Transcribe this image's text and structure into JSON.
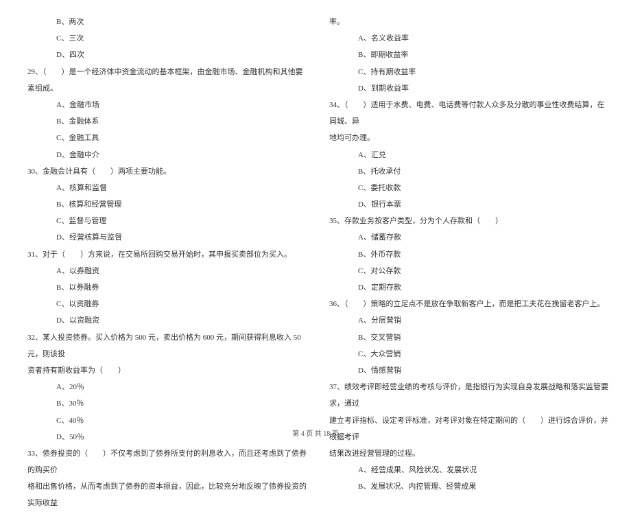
{
  "left_column": [
    {
      "type": "option",
      "text": "B、两次"
    },
    {
      "type": "option",
      "text": "C、三次"
    },
    {
      "type": "option",
      "text": "D、四次"
    },
    {
      "type": "question",
      "text": "29、（　　）是一个经济体中资金流动的基本框架，由金融市场、金融机构和其他要素组成。"
    },
    {
      "type": "option",
      "text": "A、金融市场"
    },
    {
      "type": "option",
      "text": "B、金融体系"
    },
    {
      "type": "option",
      "text": "C、金融工具"
    },
    {
      "type": "option",
      "text": "D、金融中介"
    },
    {
      "type": "question",
      "text": "30、金融会计具有（　　）两项主要功能。"
    },
    {
      "type": "option",
      "text": "A、核算和监督"
    },
    {
      "type": "option",
      "text": "B、核算和经营管理"
    },
    {
      "type": "option",
      "text": "C、监督与管理"
    },
    {
      "type": "option",
      "text": "D、经营核算与监督"
    },
    {
      "type": "question",
      "text": "31、对于（　　）方来说，在交易所回购交易开始时，其申报买卖部位为买入。"
    },
    {
      "type": "option",
      "text": "A、以券融资"
    },
    {
      "type": "option",
      "text": "B、以券融券"
    },
    {
      "type": "option",
      "text": "C、以资融券"
    },
    {
      "type": "option",
      "text": "D、以资融资"
    },
    {
      "type": "question",
      "text": "32、某人投资债券。买入价格为 500 元，卖出价格为 600 元，期间获得利息收入 50 元，则该投"
    },
    {
      "type": "question-cont",
      "text": "资者持有期收益率为（　　）"
    },
    {
      "type": "option",
      "text": "A、20％"
    },
    {
      "type": "option",
      "text": "B、30％"
    },
    {
      "type": "option",
      "text": "C、40％"
    },
    {
      "type": "option",
      "text": "D、50％"
    },
    {
      "type": "question",
      "text": "33、债券投资的（　　）不仅考虑到了债券所支付的利息收入，而且还考虑到了债券的购买价"
    },
    {
      "type": "question-cont",
      "text": "格和出售价格，从而考虑到了债券的资本损益，因此，比较充分地反映了债券投资的实际收益"
    }
  ],
  "right_column": [
    {
      "type": "question-cont",
      "text": "率。"
    },
    {
      "type": "option",
      "text": "A、名义收益率"
    },
    {
      "type": "option",
      "text": "B、即期收益率"
    },
    {
      "type": "option",
      "text": "C、持有期收益率"
    },
    {
      "type": "option",
      "text": "D、到期收益率"
    },
    {
      "type": "question",
      "text": "34、（　　）适用于水费、电费、电话费等付款人众多及分散的事业性收费结算，在同城、异"
    },
    {
      "type": "question-cont",
      "text": "地均可办理。"
    },
    {
      "type": "option",
      "text": "A、汇兑"
    },
    {
      "type": "option",
      "text": "B、托收承付"
    },
    {
      "type": "option",
      "text": "C、委托收款"
    },
    {
      "type": "option",
      "text": "D、银行本票"
    },
    {
      "type": "question",
      "text": "35、存款业务按客户类型，分为个人存款和（　　）"
    },
    {
      "type": "option",
      "text": "A、储蓄存款"
    },
    {
      "type": "option",
      "text": "B、外币存款"
    },
    {
      "type": "option",
      "text": "C、对公存款"
    },
    {
      "type": "option",
      "text": "D、定期存款"
    },
    {
      "type": "question",
      "text": "36、（　　）策略的立足点不是放在争取新客户上，而是把工夫花在挽留老客户上。"
    },
    {
      "type": "option",
      "text": "A、分层营销"
    },
    {
      "type": "option",
      "text": "B、交叉营销"
    },
    {
      "type": "option",
      "text": "C、大众营销"
    },
    {
      "type": "option",
      "text": "D、情感营销"
    },
    {
      "type": "question",
      "text": "37、绩效考评即经营业绩的考核与评价，是指银行为实现自身发展战略和落实监管要求，通过"
    },
    {
      "type": "question-cont",
      "text": "建立考评指标、设定考评标准，对考评对象在特定期间的（　　）进行综合评价，并根据考评"
    },
    {
      "type": "question-cont",
      "text": "结果改进经营管理的过程。"
    },
    {
      "type": "option",
      "text": "A、经营成果、风险状况、发展状况"
    },
    {
      "type": "option",
      "text": "B、发展状况、内控管理、经营成果"
    }
  ],
  "footer": "第 4 页 共 18 页"
}
